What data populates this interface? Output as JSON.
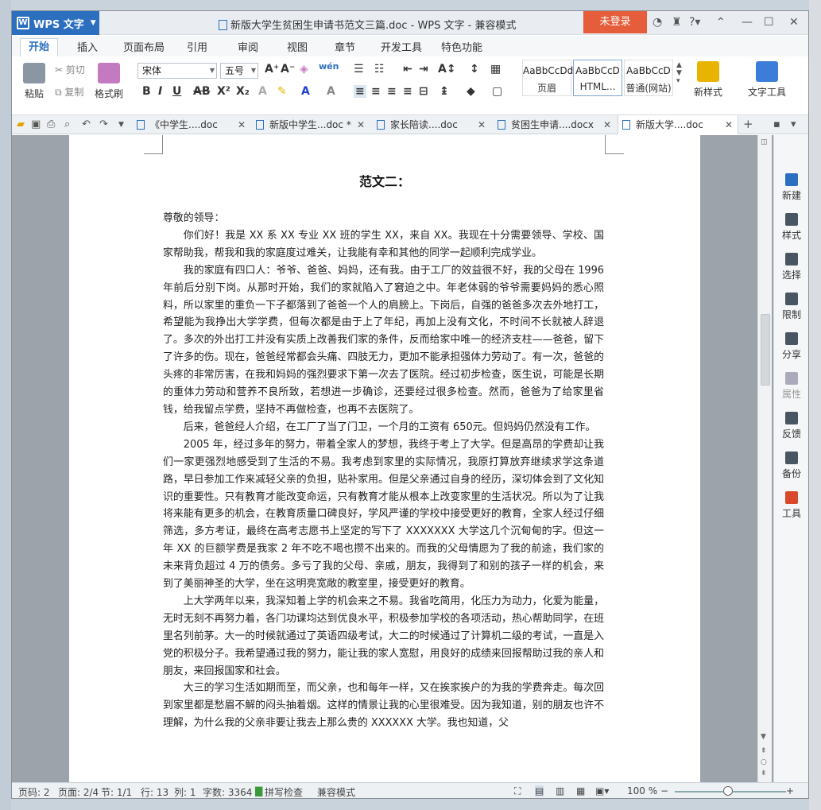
{
  "app": {
    "name": "WPS 文字",
    "window_title": "新版大学生贫困生申请书范文三篇.doc - WPS 文字 - 兼容模式",
    "login_label": "未登录"
  },
  "ribbon_tabs": [
    "开始",
    "插入",
    "页面布局",
    "引用",
    "审阅",
    "视图",
    "章节",
    "开发工具",
    "特色功能"
  ],
  "clipboard": {
    "paste": "粘贴",
    "cut": "剪切",
    "copy": "复制",
    "format_painter": "格式刷"
  },
  "font": {
    "name": "宋体",
    "size": "五号"
  },
  "styles": [
    {
      "preview": "AaBbCcDd",
      "name": "页眉"
    },
    {
      "preview": "AaBbCcD",
      "name": "HTML..."
    },
    {
      "preview": "AaBbCcD",
      "name": "普通(网站)"
    }
  ],
  "ribbon_right": {
    "new_style": "新样式",
    "text_tools": "文字工具"
  },
  "doc_tabs": [
    {
      "label": "《中学生....doc",
      "active": false
    },
    {
      "label": "新版中学生...doc *",
      "active": false
    },
    {
      "label": "家长陪读....doc",
      "active": false
    },
    {
      "label": "贫困生申请....docx",
      "active": false
    },
    {
      "label": "新版大学....doc",
      "active": true
    }
  ],
  "document": {
    "heading": "范文二：",
    "salutation": "尊敬的领导：",
    "paragraphs": [
      "你们好！我是 XX 系 XX 专业 XX 班的学生 XX，来自 XX。我现在十分需要领导、学校、国家帮助我，帮我和我的家庭度过难关，让我能有幸和其他的同学一起顺利完成学业。",
      "我的家庭有四口人：爷爷、爸爸、妈妈，还有我。由于工厂的效益很不好，我的父母在 1996 年前后分别下岗。从那时开始，我们的家就陷入了窘迫之中。年老体弱的爷爷需要妈妈的悉心照料，所以家里的重负一下子都落到了爸爸一个人的肩膀上。下岗后，自强的爸爸多次去外地打工，希望能为我挣出大学学费，但每次都是由于上了年纪，再加上没有文化，不时间不长就被人辞退了。多次的外出打工并没有实质上改善我们家的条件，反而给家中唯一的经济支柱——爸爸，留下了许多的伤。现在，爸爸经常都会头痛、四肢无力，更加不能承担强体力劳动了。有一次，爸爸的头疼的非常厉害，在我和妈妈的强烈要求下第一次去了医院。经过初步检查，医生说，可能是长期的重体力劳动和营养不良所致，若想进一步确诊，还要经过很多检查。然而，爸爸为了给家里省钱，给我留点学费，坚持不再做检查，也再不去医院了。",
      "后来，爸爸经人介绍，在工厂了当了门卫，一个月的工资有 650元。但妈妈仍然没有工作。",
      "2005 年，经过多年的努力，带着全家人的梦想，我终于考上了大学。但是高昂的学费却让我们一家更强烈地感受到了生活的不易。我考虑到家里的实际情况，我原打算放弃继续求学这条道路，早日参加工作来减轻父亲的负担，贴补家用。但是父亲通过自身的经历，深切体会到了文化知识的重要性。只有教育才能改变命运，只有教育才能从根本上改变家里的生活状况。所以为了让我将来能有更多的机会，在教育质量口碑良好，学风严谨的学校中接受更好的教育，全家人经过仔细筛选，多方考证，最终在高考志愿书上坚定的写下了 XXXXXXX 大学这几个沉甸甸的字。但这一年 XX 的巨额学费是我家 2 年不吃不喝也攒不出来的。而我的父母情愿为了我的前途，我们家的未来背负超过 4 万的债务。多亏了我的父母、亲戚，朋友，我得到了和别的孩子一样的机会，来到了美丽神圣的大学，坐在这明亮宽敞的教室里，接受更好的教育。",
      "上大学两年以来，我深知着上学的机会来之不易。我省吃简用，化压力为动力，化爱为能量，无时无刻不再努力着，各门功课均达到优良水平，积极参加学校的各项活动，热心帮助同学，在班里名列前茅。大一的时候就通过了英语四级考试，大二的时候通过了计算机二级的考试，一直是入党的积极分子。我希望通过我的努力，能让我的家人宽慰，用良好的成绩来回报帮助过我的亲人和朋友，来回报国家和社会。",
      "大三的学习生活如期而至，而父亲，也和每年一样，又在挨家挨户的为我的学费奔走。每次回到家里都是愁眉不解的闷头抽着烟。这样的情景让我的心里很难受。因为我知道，别的朋友也许不理解，为什么我的父亲非要让我去上那么贵的 XXXXXX 大学。我也知道，父"
    ]
  },
  "right_panel": [
    "新建",
    "样式",
    "选择",
    "限制",
    "分享",
    "属性",
    "反馈",
    "备份",
    "工具"
  ],
  "status": {
    "page_no": "页码: 2",
    "pages": "页面: 2/4",
    "section": "节: 1/1",
    "row": "行: 13",
    "col": "列: 1",
    "words": "字数: 3364",
    "spell": "拼写检查",
    "mode": "兼容模式",
    "zoom": "100 %"
  },
  "colors": {
    "accent": "#2c6fbf",
    "login": "#e55d3a"
  }
}
